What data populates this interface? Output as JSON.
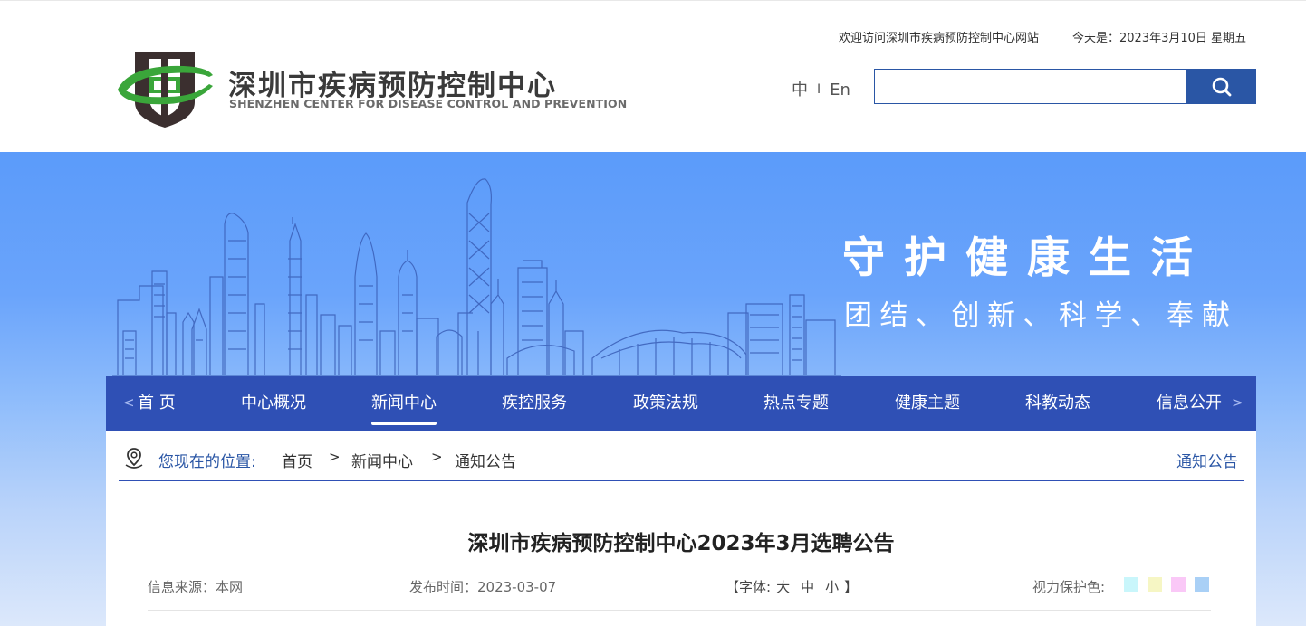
{
  "header": {
    "logo_cn": "深圳市疾病预防控制中心",
    "logo_en": "SHENZHEN CENTER FOR DISEASE CONTROL AND PREVENTION",
    "welcome": "欢迎访问深圳市疾病预防控制中心网站",
    "today": "今天是：2023年3月10日  星期五",
    "lang_cn": "中",
    "lang_sep": "I",
    "lang_en": "En",
    "search_placeholder": "",
    "search_icon": "search-icon"
  },
  "banner": {
    "slogan_main": "守护健康生活",
    "slogan_sub": "团结、创新、科学、奉献"
  },
  "nav": {
    "arrow_left": "<",
    "arrow_right": ">",
    "items": [
      {
        "label": "首 页"
      },
      {
        "label": "中心概况"
      },
      {
        "label": "新闻中心",
        "active": true
      },
      {
        "label": "疾控服务"
      },
      {
        "label": "政策法规"
      },
      {
        "label": "热点专题"
      },
      {
        "label": "健康主题"
      },
      {
        "label": "科教动态"
      },
      {
        "label": "信息公开"
      }
    ]
  },
  "breadcrumb": {
    "label": "您现在的位置:",
    "items": [
      "首页",
      "新闻中心",
      "通知公告"
    ],
    "separator": ">",
    "section": "通知公告"
  },
  "article": {
    "title": "深圳市疾病预防控制中心2023年3月选聘公告",
    "source": "信息来源：本网",
    "published": "发布时间：2023-03-07",
    "font_label_open": "【字体:",
    "font_large": "大",
    "font_medium": "中",
    "font_small": "小",
    "font_label_close": "】",
    "eye_care_label": "视力保护色:",
    "eye_care_colors": [
      "#c9f6fb",
      "#f6f6c4",
      "#fac8f7",
      "#a9d0f6"
    ]
  },
  "colors": {
    "brand_blue": "#2a56a5",
    "nav_blue": "#2f50b5",
    "logo_green": "#3aa63a",
    "logo_dark": "#3b2f2f"
  }
}
